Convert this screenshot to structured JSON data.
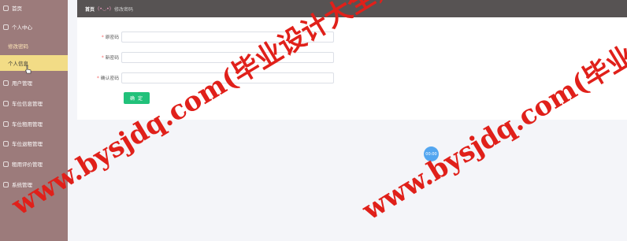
{
  "sidebar": {
    "items": [
      {
        "label": "首页",
        "icon": "home-icon"
      },
      {
        "label": "个人中心",
        "icon": "user-icon"
      },
      {
        "label": "修改密码",
        "sub": true,
        "active": true
      },
      {
        "label": "个人信息",
        "sub": true,
        "highlight": true
      },
      {
        "label": "用户管理",
        "icon": "users-icon"
      },
      {
        "label": "车位信息管理",
        "icon": "parking-icon"
      },
      {
        "label": "车位租用管理",
        "icon": "rent-icon"
      },
      {
        "label": "车位退租管理",
        "icon": "return-icon"
      },
      {
        "label": "租用评价管理",
        "icon": "comment-icon"
      },
      {
        "label": "系统管理",
        "icon": "settings-icon"
      }
    ]
  },
  "breadcrumb": {
    "home": "首页",
    "decoration": "(•◡•)",
    "current": "修改密码"
  },
  "form": {
    "old_password_label": "原密码",
    "new_password_label": "新密码",
    "confirm_password_label": "确认密码",
    "required_mark": "*",
    "submit_label": "确 定"
  },
  "floating_indicator": "00:00",
  "watermark": {
    "line1": "www.bysjdq.com(毕业设计大全)",
    "line2": "www.bysjdq.com(毕业设计大全)"
  },
  "colors": {
    "sidebar_bg": "#9c7b7b",
    "highlight": "#f2dc86",
    "topbar": "#575353",
    "button": "#21c17a",
    "watermark": "#e0201a"
  }
}
